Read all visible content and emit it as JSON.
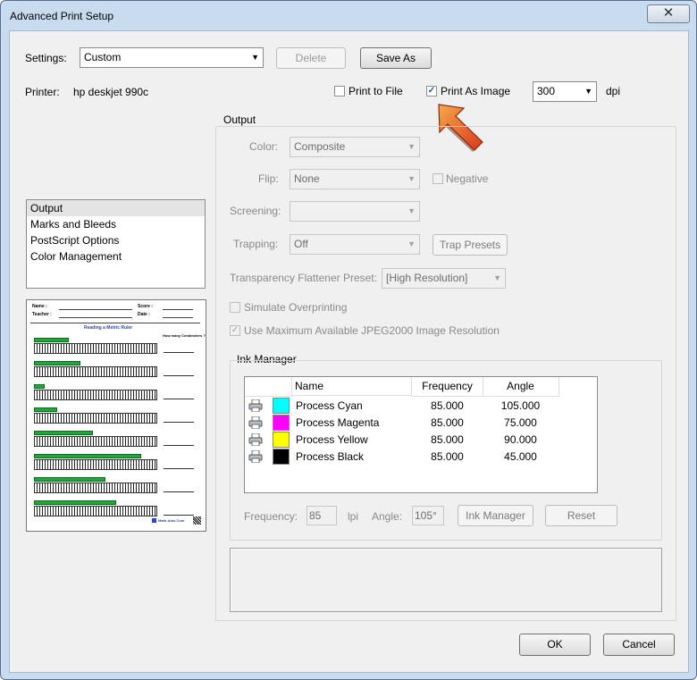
{
  "window": {
    "title": "Advanced Print Setup",
    "close_glyph": "✕"
  },
  "settings": {
    "label": "Settings:",
    "value": "Custom",
    "delete_label": "Delete",
    "save_as_label": "Save As"
  },
  "printer": {
    "label": "Printer:",
    "name": "hp deskjet 990c"
  },
  "print_to_file": {
    "label": "Print to File",
    "checked": false
  },
  "print_as_image": {
    "label": "Print As Image",
    "checked": true,
    "dpi_value": "300",
    "dpi_unit": "dpi"
  },
  "sidebar": {
    "items": [
      {
        "label": "Output",
        "selected": true
      },
      {
        "label": "Marks and Bleeds",
        "selected": false
      },
      {
        "label": "PostScript Options",
        "selected": false
      },
      {
        "label": "Color Management",
        "selected": false
      }
    ]
  },
  "preview": {
    "name_label": "Name :",
    "teacher_label": "Teacher :",
    "score_label": "Score :",
    "date_label": "Date :",
    "heading": "Reading a Metric Ruler",
    "question": "How many Centimeters ?",
    "bar_fractions": [
      0.28,
      0.38,
      0.09,
      0.19,
      0.48,
      0.87,
      0.58,
      0.67
    ],
    "footer": "Math-Aids.Com"
  },
  "output": {
    "section_title": "Output",
    "color_label": "Color:",
    "color_value": "Composite",
    "flip_label": "Flip:",
    "flip_value": "None",
    "negative_label": "Negative",
    "screening_label": "Screening:",
    "screening_value": "",
    "trapping_label": "Trapping:",
    "trapping_value": "Off",
    "trap_presets_label": "Trap Presets",
    "flattener_label": "Transparency Flattener Preset:",
    "flattener_value": "[High Resolution]",
    "simulate_overprinting_label": "Simulate Overprinting",
    "max_jpeg_label": "Use Maximum Available JPEG2000 Image Resolution"
  },
  "ink_manager": {
    "title": "Ink Manager",
    "columns": [
      "Name",
      "Frequency",
      "Angle"
    ],
    "inks": [
      {
        "name": "Process Cyan",
        "frequency": "85.000",
        "angle": "105.000",
        "color": "#00ffff"
      },
      {
        "name": "Process Magenta",
        "frequency": "85.000",
        "angle": "75.000",
        "color": "#ff00ff"
      },
      {
        "name": "Process Yellow",
        "frequency": "85.000",
        "angle": "90.000",
        "color": "#ffff00"
      },
      {
        "name": "Process Black",
        "frequency": "85.000",
        "angle": "45.000",
        "color": "#000000"
      }
    ],
    "frequency_label": "Frequency:",
    "frequency_value": "85",
    "lpi_label": "lpi",
    "angle_label": "Angle:",
    "angle_value": "105°",
    "ink_manager_button": "Ink Manager",
    "reset_button": "Reset"
  },
  "footer": {
    "ok_label": "OK",
    "cancel_label": "Cancel"
  },
  "colors": {
    "accent_arrow": "#e8501e",
    "frame": "#c9dcef"
  }
}
